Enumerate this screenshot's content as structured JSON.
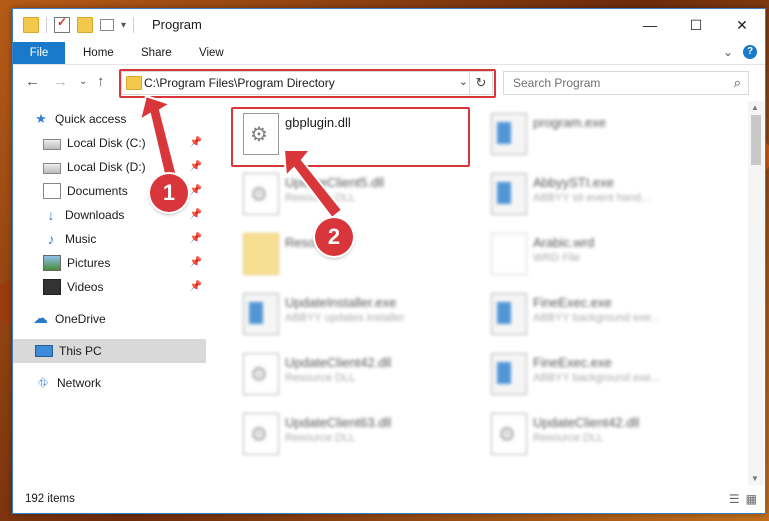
{
  "window": {
    "title": "Program",
    "controls": {
      "minimize": "—",
      "maximize": "☐",
      "close": "✕"
    }
  },
  "ribbon": {
    "tabs": [
      "File",
      "Home",
      "Share",
      "View"
    ],
    "expand": "⌄",
    "help": "?"
  },
  "nav": {
    "back": "←",
    "forward": "→",
    "recent": "⌄",
    "up": "↑"
  },
  "address": {
    "path": "C:\\Program Files\\Program Directory",
    "dropdown": "⌄",
    "refresh": "↻"
  },
  "search": {
    "placeholder": "Search Program",
    "icon": "search-icon"
  },
  "sidebar": {
    "items": [
      {
        "label": "Quick access",
        "icon": "star-icon"
      },
      {
        "label": "Local Disk (C:)",
        "icon": "disk-icon",
        "pinned": true
      },
      {
        "label": "Local Disk (D:)",
        "icon": "disk-icon",
        "pinned": true
      },
      {
        "label": "Documents",
        "icon": "document-icon",
        "pinned": true
      },
      {
        "label": "Downloads",
        "icon": "download-icon",
        "pinned": true
      },
      {
        "label": "Music",
        "icon": "music-icon",
        "pinned": true
      },
      {
        "label": "Pictures",
        "icon": "pictures-icon",
        "pinned": true
      },
      {
        "label": "Videos",
        "icon": "videos-icon",
        "pinned": true
      },
      {
        "label": "OneDrive",
        "icon": "cloud-icon"
      },
      {
        "label": "This PC",
        "icon": "pc-icon",
        "selected": true
      },
      {
        "label": "Network",
        "icon": "network-icon"
      }
    ]
  },
  "files": [
    {
      "name": "gbplugin.dll",
      "type": "",
      "icon": "dll-icon"
    },
    {
      "name": "program.exe",
      "type": "",
      "icon": "exe-icon"
    },
    {
      "name": "UpdateClient5.dll",
      "type": "Resource DLL",
      "icon": "dll-icon"
    },
    {
      "name": "AbbyySTI.exe",
      "type": "ABBYY sti event hand...",
      "icon": "exe-icon"
    },
    {
      "name": "Resou...",
      "type": "",
      "icon": "folder-icon"
    },
    {
      "name": "Arabic.wrd",
      "type": "WRD File",
      "icon": "file-icon"
    },
    {
      "name": "UpdateInstaller.exe",
      "type": "ABBYY updates installer",
      "icon": "exe-icon"
    },
    {
      "name": "FineExec.exe",
      "type": "ABBYY background exe...",
      "icon": "exe-icon"
    },
    {
      "name": "UpdateClient42.dll",
      "type": "Resource DLL",
      "icon": "dll-icon"
    },
    {
      "name": "FineExec.exe",
      "type": "ABBYY background exe...",
      "icon": "exe-icon"
    },
    {
      "name": "UpdateClient63.dll",
      "type": "Resource DLL",
      "icon": "dll-icon"
    },
    {
      "name": "UpdateClient42.dll",
      "type": "Resource DLL",
      "icon": "dll-icon"
    }
  ],
  "status": {
    "count": "192 items"
  },
  "callouts": [
    "1",
    "2"
  ],
  "colors": {
    "accent": "#1979ca",
    "highlight": "#d8363a"
  }
}
